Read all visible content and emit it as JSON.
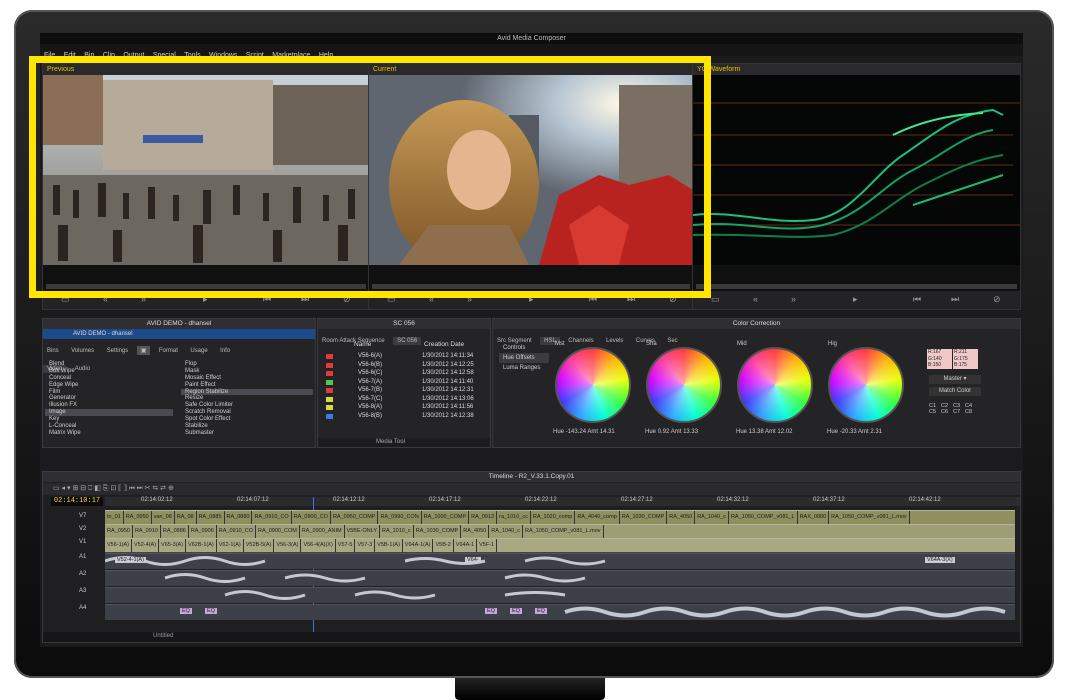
{
  "app": {
    "title": "Avid Media Composer"
  },
  "menu": [
    "File",
    "Edit",
    "Bin",
    "Clip",
    "Output",
    "Special",
    "Tools",
    "Windows",
    "Script",
    "Marketplace",
    "Help"
  ],
  "viewers": {
    "previous_label": "Previous",
    "current_label": "Current",
    "waveform_label": "YC Waveform"
  },
  "effects_panel": {
    "title": "AVID DEMO - dhansel",
    "project": "AVID DEMO - dhansel",
    "tabs": [
      "Bins",
      "Volumes",
      "Settings",
      "Format",
      "Usage",
      "Info"
    ],
    "subtabs": [
      "Video",
      "Audio"
    ],
    "categories": [
      "Blend",
      "Box Wipe",
      "Conceal",
      "Edge Wipe",
      "Film",
      "Generator",
      "Illusion FX",
      "Image",
      "Key",
      "L-Conceal",
      "Matrix Wipe"
    ],
    "effects": [
      "Flop",
      "Mask",
      "Mosaic Effect",
      "Paint Effect",
      "Region Stabilize",
      "Resize",
      "Safe Color Limiter",
      "Scratch Removal",
      "Spot Color Effect",
      "Stabilize",
      "Submaster"
    ]
  },
  "bin_panel": {
    "title": "SC 056",
    "tabs": [
      "Room Attack Sequence",
      "SC 056"
    ],
    "columns": [
      "Name",
      "Creation Date"
    ],
    "rows": [
      {
        "name": "V56-6(A)",
        "date": "1/30/2012 14:11:34",
        "color": "#e23a3a"
      },
      {
        "name": "V56-6(B)",
        "date": "1/30/2012 14:12:25",
        "color": "#e23a3a"
      },
      {
        "name": "V56-6(C)",
        "date": "1/30/2012 14:12:58",
        "color": "#e23a3a"
      },
      {
        "name": "V56-7(A)",
        "date": "1/30/2012 14:11:40",
        "color": "#4ec94e"
      },
      {
        "name": "V56-7(B)",
        "date": "1/30/2012 14:12:31",
        "color": "#e23a3a"
      },
      {
        "name": "V56-7(C)",
        "date": "1/30/2012 14:13:06",
        "color": "#d8d840"
      },
      {
        "name": "V56-8(A)",
        "date": "1/30/2012 14:11:56",
        "color": "#d8d840"
      },
      {
        "name": "V56-8(B)",
        "date": "1/30/2012 14:12:38",
        "color": "#3a7ae2"
      }
    ],
    "footer_label": "Media Tool"
  },
  "color_correction": {
    "title": "Color Correction",
    "tabs": [
      "Src Segment",
      "HSL",
      "Channels",
      "Levels",
      "Curves",
      "Sec"
    ],
    "side_tabs": [
      "Controls",
      "Hue Offsets",
      "Luma Ranges"
    ],
    "wheels": [
      {
        "label": "Mst",
        "hue_label": "Hue",
        "hue": "-143.24",
        "amt_label": "Amt",
        "amt": "14.31"
      },
      {
        "label": "Sha",
        "hue_label": "Hue",
        "hue": "0.92",
        "amt_label": "Amt",
        "amt": "13.33"
      },
      {
        "label": "Mid",
        "hue_label": "Hue",
        "hue": "13.38",
        "amt_label": "Amt",
        "amt": "12.02"
      },
      {
        "label": "Hig",
        "hue_label": "Hue",
        "hue": "-20.33",
        "amt_label": "Amt",
        "amt": "2.31"
      }
    ],
    "rgb_left": {
      "r": "R:167",
      "g": "G:140",
      "b": "B:150"
    },
    "rgb_right": {
      "r": "R:211",
      "g": "G:175",
      "b": "B:175"
    },
    "master_label": "Master",
    "match_color_label": "Match Color",
    "grid_buttons": [
      "C1",
      "C2",
      "C3",
      "C4",
      "C5",
      "C6",
      "C7",
      "C8"
    ]
  },
  "timeline": {
    "title": "Timeline - R2_V.33.1.Copy.01",
    "timecode": "02:14:10:17",
    "ruler": [
      "02:14:02:12",
      "02:14:07:12",
      "02:14:12:12",
      "02:14:17:12",
      "02:14:22:12",
      "02:14:27:12",
      "02:14:32:12",
      "02:14:37:12",
      "02:14:42:12"
    ],
    "tracks": [
      "V7",
      "V2",
      "V1",
      "A1",
      "A2",
      "A3",
      "A4"
    ],
    "v7_clips": [
      "to_01",
      "RA_0950",
      "van_08",
      "RA_08",
      "RA_0885",
      "RA_0880",
      "RA_0910_CO",
      "RA_0900_CO",
      "RA_0950_COMP",
      "RA_0990_CON",
      "RA_1000_COMP",
      "RA_0913",
      "ra_1010_cc",
      "RA_1020_comp",
      "RA_4040_comp",
      "RA_1030_COMP",
      "RA_4050",
      "RA_1040_c",
      "RA_1050_COMP_v081_L",
      "RAX_0880",
      "RA_1050_COMP_v081_L.mov"
    ],
    "v2_clips": [
      "RA_0950",
      "RA_0910",
      "RA_0886",
      "RA_0906",
      "RA_0910_CO",
      "RA_0900_COM",
      "RA_0900_ANIM",
      "V5BE-ONLY",
      "RA_1010_c",
      "RA_1030_COMP",
      "RA_4050",
      "RA_1040_c",
      "RA_1050_COMP_v081_L.mov"
    ],
    "v1_clips": [
      "V56-1(A)",
      "V52-4(A)",
      "V65-3(A)",
      "V62B-1(A)",
      "V62-1(A)",
      "V52B-5(A)",
      "V56-3(A)",
      "V56-4(A)(X)",
      "V57-5",
      "V57-3",
      "V5B-1(A)",
      "V64A-1(A)",
      "V5B-2",
      "V64A-1",
      "V5F-1"
    ],
    "a1_clips": [
      "V52-4-1(A)",
      "V64-",
      "V64A-3(X)"
    ],
    "a4_labels": [
      "EQ",
      "EQ",
      "EQ",
      "EQ",
      "EQ"
    ],
    "footer_label": "Untitled"
  }
}
